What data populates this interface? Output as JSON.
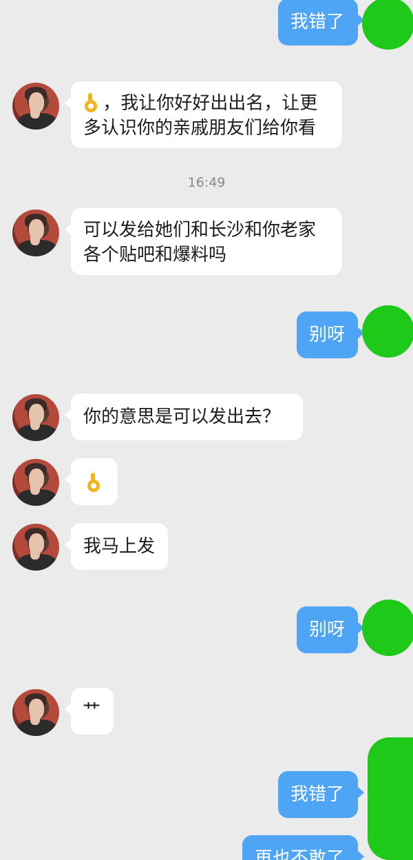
{
  "messages": {
    "m1": {
      "text": "我错了"
    },
    "m2": {
      "line1": "，我让你好好出出名，让更",
      "line2": "多认识你的亲戚朋友们给你看"
    },
    "timestamp": "16:49",
    "m3": {
      "line1": "可以发给她们和长沙和你老家",
      "line2": "各个贴吧和爆料吗"
    },
    "m4": {
      "text": "别呀"
    },
    "m5": {
      "text": "你的意思是可以发出去？"
    },
    "m6": {
      "icon": "ok-hand-icon"
    },
    "m7": {
      "text": "我马上发"
    },
    "m8": {
      "text": "别呀"
    },
    "m9": {
      "text": "艹"
    },
    "m10": {
      "text": "我错了"
    },
    "m11": {
      "text": "再也不敢了"
    }
  },
  "colors": {
    "background": "#ebebeb",
    "incoming_bubble": "#ffffff",
    "outgoing_bubble": "#4ea5f5",
    "self_avatar": "#1fc919",
    "ok_emoji": "#f3b41a"
  }
}
